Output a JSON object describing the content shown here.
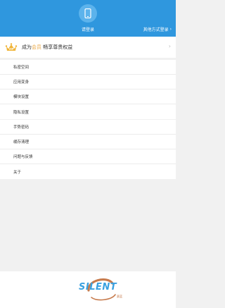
{
  "header": {
    "login_label": "请登录",
    "other_login_label": "其他方式登录",
    "other_login_chevron": "›",
    "bg_color": "#2f97de"
  },
  "vip": {
    "text_prefix": "成为",
    "text_highlight": "会员",
    "text_suffix": " 畅享尊贵权益",
    "badge_text": "VIP",
    "arrow": "›",
    "highlight_color": "#e8a640"
  },
  "menu_group_1": [
    {
      "label": "私密空间"
    },
    {
      "label": "应用变身"
    },
    {
      "label": "模块设置"
    },
    {
      "label": "隐私设置"
    }
  ],
  "menu_group_2": [
    {
      "label": "手势密码"
    },
    {
      "label": "缓存清理"
    },
    {
      "label": "问题与反馈"
    },
    {
      "label": "关于"
    }
  ],
  "footer": {
    "logo_text": "SILENT",
    "logo_sub": "赛蓝"
  },
  "icons": {
    "login": "phone-icon",
    "vip": "crown-icon",
    "chevron": "chevron-right-icon"
  }
}
